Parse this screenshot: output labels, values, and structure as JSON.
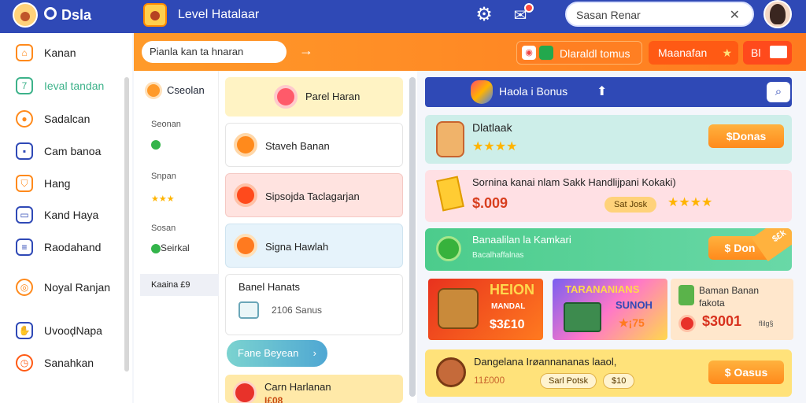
{
  "topbar": {
    "app_title": "Dsla",
    "level_title": "Level Hatalaar",
    "search_value": "Sasan Renar"
  },
  "sidebar": {
    "items": [
      {
        "label": "Kanan",
        "icon": "home-icon"
      },
      {
        "label": "Ieval tandan",
        "icon": "square-icon"
      },
      {
        "label": "Sadalcan",
        "icon": "user-icon"
      },
      {
        "label": "Cam banoa",
        "icon": "card-icon"
      },
      {
        "label": "Hang",
        "icon": "shield-icon"
      },
      {
        "label": "Kand Haya",
        "icon": "window-icon"
      },
      {
        "label": "Raodahand",
        "icon": "document-icon"
      },
      {
        "label": "Noyal Ranjan",
        "icon": "circle-icon"
      },
      {
        "label": "UvooḑNapa",
        "icon": "hand-icon"
      },
      {
        "label": "Sanahkan",
        "icon": "clock-icon"
      }
    ]
  },
  "orangebar": {
    "search_placeholder": "Pianla kan ta hnaran",
    "btn1_label": "Dlaraldl tomus",
    "btn2_label": "Maanafan",
    "btn3_label": "Bl"
  },
  "col1": {
    "title": "Cseolan",
    "label1": "Seonan",
    "label2": "Snpan",
    "label3": "Sosan",
    "green_text": "Seirkal",
    "footer": "Kaaina £9"
  },
  "col2": {
    "cards": [
      {
        "label": "Parel Haran"
      },
      {
        "label": "Staveh Banan"
      },
      {
        "label": "Sipsojda Taclagarjan"
      },
      {
        "label": "Signa Hawlah"
      },
      {
        "label": "Banel Hanats"
      }
    ],
    "bonus_value": "2106 Sanus",
    "pill_label": "Fane Beyean",
    "bottom_label": "Carn Harlanan",
    "bottom_value": "I£08"
  },
  "right": {
    "header_title": "Haola i Bonus",
    "row1": {
      "name": "Dlatlaak",
      "rating": 4,
      "button": "$Donas"
    },
    "row2": {
      "text": "Sornina kanai nlam Sakk Handlijpani Kokaki)",
      "value": "$.009",
      "tag": "Sat Josk",
      "rating": 4
    },
    "row3": {
      "text": "Banaalilan la Kamkari",
      "subtext": "Bacalhaffalnas",
      "button": "$ Don",
      "ribbon": "$£k"
    },
    "tile1": {
      "title": "HEION",
      "subtitle": "MANDAL",
      "value": "$3£10"
    },
    "tile2": {
      "title": "TARANANIANS",
      "subtitle": "SUNOH",
      "value": "★¡75"
    },
    "tile3": {
      "line1": "Baman Banan",
      "line2": "fakota",
      "value": "$3001",
      "tag": "flilg§"
    },
    "row4": {
      "text": "Dangelana Irøannananas laaol,",
      "value": "11£000",
      "tag": "Sarl Potsk",
      "badge": "$10",
      "button": "$ Oasus"
    }
  },
  "colors": {
    "topbar": "#2f49b6",
    "accent": "#ff8a1c",
    "teal": "#3db28a"
  }
}
